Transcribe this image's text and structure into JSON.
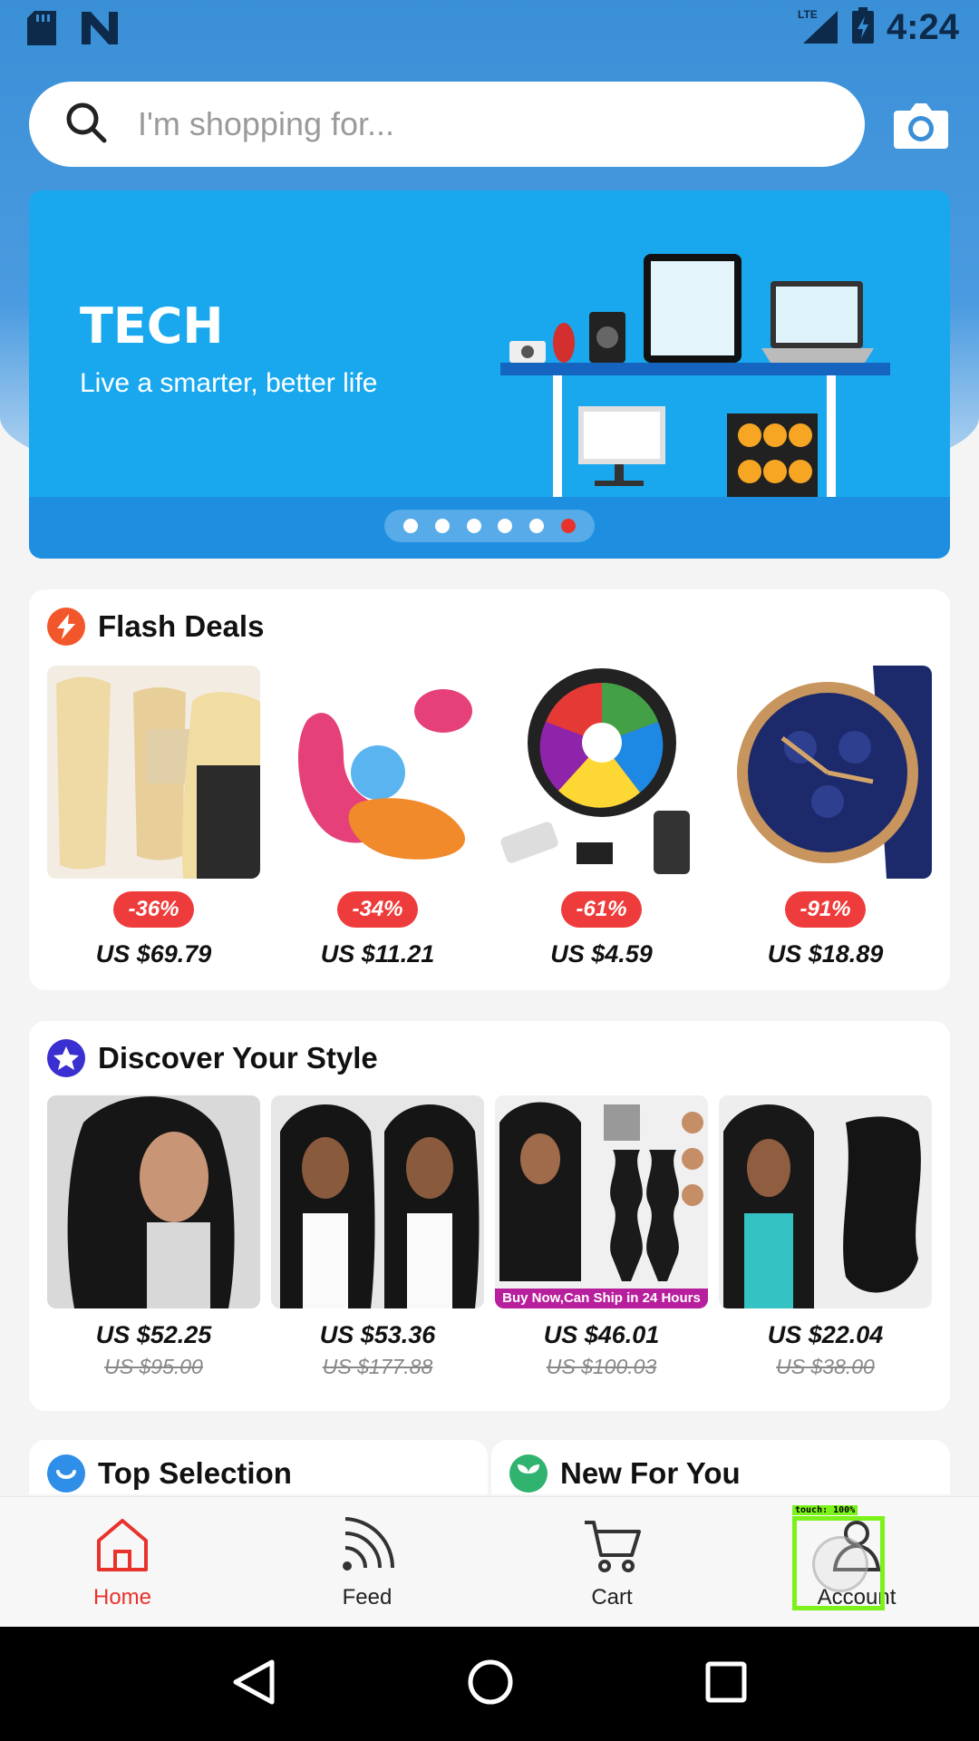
{
  "status": {
    "time": "4:24",
    "network": "LTE"
  },
  "search": {
    "placeholder": "I'm shopping for..."
  },
  "banner": {
    "title": "TECH",
    "subtitle": "Live a smarter, better life",
    "dots": 6,
    "active_dot": 6
  },
  "flash_deals": {
    "title": "Flash Deals",
    "items": [
      {
        "discount": "-36%",
        "price": "US $69.79",
        "image": "blonde-hair-bundles"
      },
      {
        "discount": "-34%",
        "price": "US $11.21",
        "image": "pink-massager"
      },
      {
        "discount": "-61%",
        "price": "US $4.59",
        "image": "rgb-led-strip"
      },
      {
        "discount": "-91%",
        "price": "US $18.89",
        "image": "blue-wristwatch"
      }
    ]
  },
  "discover": {
    "title": "Discover Your Style",
    "items": [
      {
        "price": "US $52.25",
        "old_price": "US $95.00",
        "image": "curly-wig"
      },
      {
        "price": "US $53.36",
        "old_price": "US $177.88",
        "image": "wavy-wig"
      },
      {
        "price": "US $46.01",
        "old_price": "US $100.03",
        "image": "hair-bundles",
        "caption": "Buy Now,Can Ship in 24 Hours"
      },
      {
        "price": "US $22.04",
        "old_price": "US $38.00",
        "image": "body-wave-bundles"
      }
    ]
  },
  "sections": {
    "top_selection": "Top Selection",
    "new_for_you": "New For You"
  },
  "nav": {
    "home": "Home",
    "feed": "Feed",
    "cart": "Cart",
    "account": "Account"
  },
  "overlay": {
    "touch_label": "touch: 100%"
  },
  "colors": {
    "accent": "#e8322c",
    "brand_blue": "#3a8fd6",
    "touch": "#7cf21b"
  }
}
